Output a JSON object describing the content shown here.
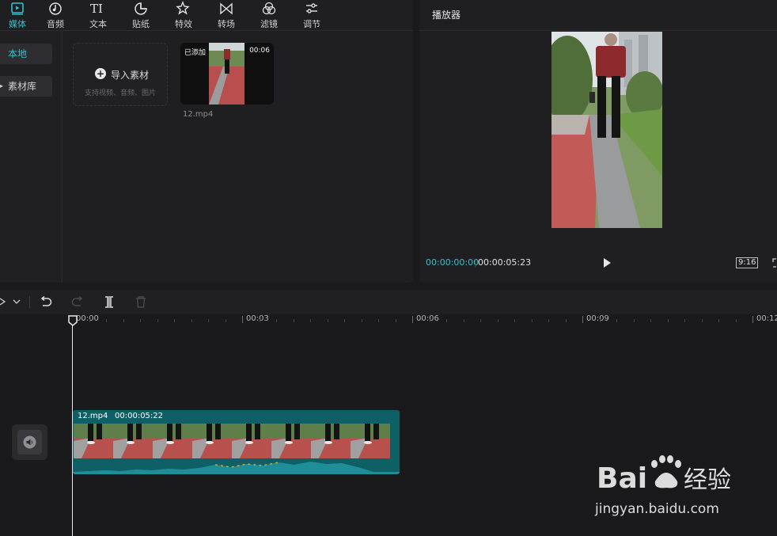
{
  "toolbar": {
    "tabs": [
      {
        "label": "媒体",
        "icon": "media-icon",
        "active": true
      },
      {
        "label": "音频",
        "icon": "audio-icon"
      },
      {
        "label": "文本",
        "icon": "text-icon"
      },
      {
        "label": "贴纸",
        "icon": "sticker-icon"
      },
      {
        "label": "特效",
        "icon": "effects-icon"
      },
      {
        "label": "转场",
        "icon": "transition-icon"
      },
      {
        "label": "滤镜",
        "icon": "filter-icon"
      },
      {
        "label": "调节",
        "icon": "adjust-icon"
      }
    ]
  },
  "sidebar": {
    "items": [
      {
        "label": "本地",
        "active": true
      },
      {
        "label": "素材库"
      }
    ]
  },
  "media": {
    "import_label": "导入素材",
    "import_hint": "支持视频、音频、图片",
    "clip": {
      "name": "12.mp4",
      "badge": "已添加",
      "duration": "00:06"
    }
  },
  "player": {
    "title": "播放器",
    "current_time": "00:00:00:00",
    "separator": "|",
    "total_time": "00:00:05:23",
    "aspect_ratio": "9:16"
  },
  "timeline": {
    "ruler_labels": [
      "00:00",
      "00:03",
      "00:06",
      "00:09",
      "00:12"
    ],
    "clip": {
      "name": "12.mp4",
      "duration": "00:00:05:22"
    },
    "playhead_position": "00:00"
  },
  "watermark": {
    "brand": "Baidu",
    "brand_suffix": "经验",
    "url": "jingyan.baidu.com"
  },
  "colors": {
    "accent": "#2fc2cf",
    "clip": "#0f5f66",
    "panel": "#1f1f21",
    "background": "#1a1a1c"
  }
}
